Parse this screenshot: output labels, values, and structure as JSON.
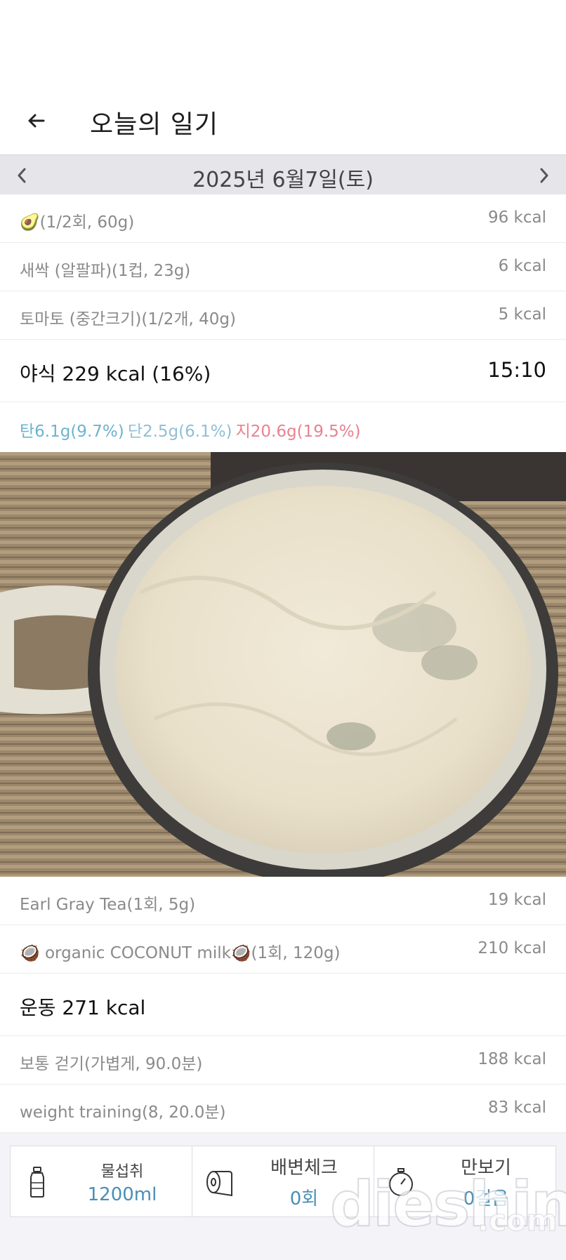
{
  "header": {
    "title": "오늘의 일기"
  },
  "date_bar": {
    "date": "2025년 6월7일(토)"
  },
  "foods_top": [
    {
      "name": "🥑(1/2회, 60g)",
      "kcal": "96 kcal"
    },
    {
      "name": "새싹 (알팔파)(1컵, 23g)",
      "kcal": "6 kcal"
    },
    {
      "name": "토마토 (중간크기)(1/2개, 40g)",
      "kcal": "5 kcal"
    }
  ],
  "meal": {
    "title": "야식 229 kcal (16%)",
    "time": "15:10"
  },
  "macros": {
    "carb": "탄6.1g(9.7%)",
    "protein": "단2.5g(6.1%)",
    "fat": "지20.6g(19.5%)"
  },
  "foods_bottom": [
    {
      "name": "Earl Gray Tea(1회, 5g)",
      "kcal": "19 kcal"
    },
    {
      "name": "🥥 organic COCONUT milk🥥(1회, 120g)",
      "kcal": "210 kcal"
    }
  ],
  "exercise": {
    "title": "운동 271 kcal",
    "items": [
      {
        "name": "보통 걷기(가볍게, 90.0분)",
        "kcal": "188 kcal"
      },
      {
        "name": "weight training(8, 20.0분)",
        "kcal": "83 kcal"
      }
    ]
  },
  "widgets": [
    {
      "label": "물섭취",
      "value": "1200ml",
      "icon": "water-bottle-icon"
    },
    {
      "label": "배변체크",
      "value": "0회",
      "icon": "toilet-paper-icon"
    },
    {
      "label": "만보기",
      "value": "0걸음",
      "icon": "stopwatch-icon"
    }
  ],
  "watermark": {
    "brand": "dieshin",
    "suffix": ".com"
  },
  "colors": {
    "carb": "#6db3cf",
    "protein": "#8fbfd6",
    "fat": "#e8828f",
    "value": "#4a8fb5"
  }
}
